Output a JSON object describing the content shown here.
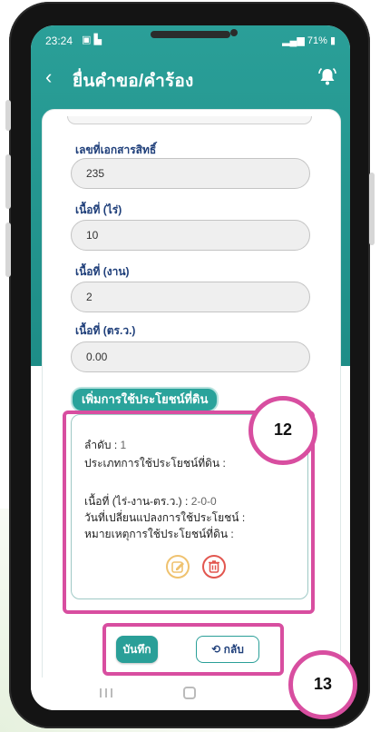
{
  "status": {
    "time": "23:24",
    "icons_left": "▣ ▙",
    "battery": "71%"
  },
  "header": {
    "title": "ยื่นคำขอ/คำร้อง",
    "back_icon": "chevron-left-icon",
    "bell_icon": "bell-icon"
  },
  "form": {
    "fields": [
      {
        "label": "เลขที่เอกสารสิทธิ์",
        "value": "235"
      },
      {
        "label": "เนื้อที่ (ไร่)",
        "value": "10"
      },
      {
        "label": "เนื้อที่ (งาน)",
        "value": "2"
      },
      {
        "label": "เนื้อที่ (ตร.ว.)",
        "value": "0.00"
      }
    ],
    "add_land_use_label": "เพิ่มการใช้ประโยชน์ที่ดิน"
  },
  "land_use_item": {
    "order_label": "ลำดับ :",
    "order_value": "1",
    "type_label": "ประเภทการใช้ประโยชน์ที่ดิน :",
    "type_value": "",
    "area_label": "เนื้อที่ (ไร่-งาน-ตร.ว.) :",
    "area_value": "2-0-0",
    "change_date_label": "วันที่เปลี่ยนแปลงการใช้ประโยชน์ :",
    "change_date_value": "",
    "note_label": "หมายเหตุการใช้ประโยชน์ที่ดิน :",
    "note_value": ""
  },
  "actions": {
    "save_label": "บันทึก",
    "back_label": "⟲ กลับ"
  },
  "callouts": {
    "item_callout": "12",
    "buttons_callout": "13"
  },
  "colors": {
    "teal": "#2a9f98",
    "label_blue": "#1f3f7a",
    "highlight_pink": "#d84ea0",
    "edit_orange": "#efc26f",
    "delete_red": "#e2564f"
  }
}
